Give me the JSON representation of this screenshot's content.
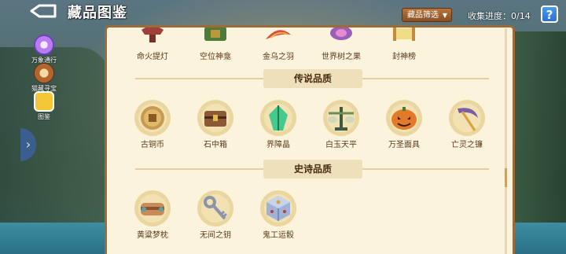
{
  "header": {
    "title": "藏品图鉴",
    "filter_label": "藏品筛选",
    "progress_text": "收集进度：0/14",
    "help_label": "?"
  },
  "sidebar": {
    "items": [
      {
        "label": "万象通行",
        "icon": "swirl-pass-icon",
        "active": false
      },
      {
        "label": "猫藏寻宝",
        "icon": "treasure-map-icon",
        "active": false
      },
      {
        "label": "图鉴",
        "icon": "codex-book-icon",
        "active": true
      }
    ],
    "expand_icon": "chevron-right-icon"
  },
  "collection": {
    "top_row": [
      {
        "name": "命火提灯",
        "icon": "lantern-icon"
      },
      {
        "name": "空位神龛",
        "icon": "shrine-icon"
      },
      {
        "name": "金乌之羽",
        "icon": "feather-icon"
      },
      {
        "name": "世界树之果",
        "icon": "fruit-icon"
      },
      {
        "name": "封神榜",
        "icon": "scroll-icon"
      }
    ],
    "sections": [
      {
        "title": "传说品质",
        "items": [
          {
            "name": "古铜币",
            "icon": "bronze-coin-icon"
          },
          {
            "name": "石中箱",
            "icon": "stone-chest-icon"
          },
          {
            "name": "界障晶",
            "icon": "green-crystal-icon"
          },
          {
            "name": "白玉天平",
            "icon": "jade-scale-icon"
          },
          {
            "name": "万圣面具",
            "icon": "pumpkin-mask-icon"
          },
          {
            "name": "亡灵之镰",
            "icon": "scythe-icon"
          }
        ]
      },
      {
        "title": "史诗品质",
        "items": [
          {
            "name": "黄粱梦枕",
            "icon": "dream-pillow-icon"
          },
          {
            "name": "无间之钥",
            "icon": "key-icon"
          },
          {
            "name": "鬼工运骰",
            "icon": "dice-icon"
          }
        ]
      }
    ]
  },
  "colors": {
    "panel_bg": "#fbf3dc",
    "panel_border": "#9b6b3c",
    "label_text": "#5a3a1c",
    "filter_btn": "#a5622e",
    "help_btn": "#3b86e6"
  }
}
